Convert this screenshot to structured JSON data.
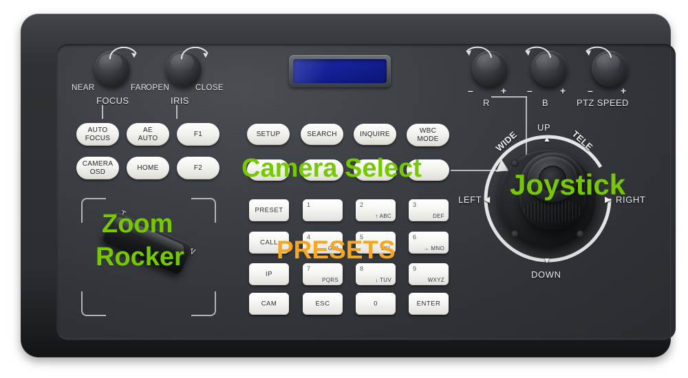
{
  "device": {
    "name": "PTZ camera joystick controller",
    "body_color": "#2e3135",
    "faceplate_color": "#3b3e43"
  },
  "display": {
    "name": "lcd-screen",
    "backlight_color": "#16239a",
    "text": ""
  },
  "knobs": [
    {
      "name": "focus",
      "label": "FOCUS",
      "left_label": "NEAR",
      "right_label": "FAR"
    },
    {
      "name": "iris",
      "label": "IRIS",
      "left_label": "OPEN",
      "right_label": "CLOSE"
    },
    {
      "name": "r-gain",
      "label": "R",
      "left_label": "–",
      "right_label": "+"
    },
    {
      "name": "b-gain",
      "label": "B",
      "left_label": "–",
      "right_label": "+"
    },
    {
      "name": "ptz-speed",
      "label": "PTZ SPEED",
      "left_label": "–",
      "right_label": "+"
    }
  ],
  "function_buttons": [
    {
      "name": "auto-focus",
      "line1": "AUTO",
      "line2": "FOCUS"
    },
    {
      "name": "ae-auto",
      "line1": "AE",
      "line2": "AUTO"
    },
    {
      "name": "f1",
      "line1": "F1",
      "line2": ""
    },
    {
      "name": "camera-osd",
      "line1": "CAMERA",
      "line2": "OSD"
    },
    {
      "name": "home",
      "line1": "HOME",
      "line2": ""
    },
    {
      "name": "f2",
      "line1": "F2",
      "line2": ""
    }
  ],
  "menu_buttons": [
    {
      "name": "setup",
      "line1": "SETUP",
      "line2": ""
    },
    {
      "name": "search",
      "line1": "SEARCH",
      "line2": ""
    },
    {
      "name": "inquire",
      "line1": "INQUIRE",
      "line2": ""
    },
    {
      "name": "wbc-mode",
      "line1": "WBC",
      "line2": "MODE"
    }
  ],
  "camera_select_buttons": [
    {
      "name": "camera-select-1",
      "label": ""
    },
    {
      "name": "camera-select-2",
      "label": ""
    },
    {
      "name": "camera-select-3",
      "label": ""
    },
    {
      "name": "camera-select-4",
      "label": ""
    }
  ],
  "keypad": {
    "rows": [
      [
        {
          "name": "preset",
          "main": "PRESET",
          "num": "",
          "sub": ""
        },
        {
          "name": "key-1",
          "main": "",
          "num": "1",
          "sub": ""
        },
        {
          "name": "key-2",
          "main": "",
          "num": "2",
          "sub": "↑ ABC"
        },
        {
          "name": "key-3",
          "main": "",
          "num": "3",
          "sub": "DEF"
        }
      ],
      [
        {
          "name": "call",
          "main": "CALL",
          "num": "",
          "sub": ""
        },
        {
          "name": "key-4",
          "main": "",
          "num": "4",
          "sub": "GHI"
        },
        {
          "name": "key-5",
          "main": "",
          "num": "5",
          "sub": "JKL"
        },
        {
          "name": "key-6",
          "main": "",
          "num": "6",
          "sub": "→ MNO"
        }
      ],
      [
        {
          "name": "ip",
          "main": "IP",
          "num": "",
          "sub": ""
        },
        {
          "name": "key-7",
          "main": "",
          "num": "7",
          "sub": "PQRS"
        },
        {
          "name": "key-8",
          "main": "",
          "num": "8",
          "sub": "↓ TUV"
        },
        {
          "name": "key-9",
          "main": "",
          "num": "9",
          "sub": "WXYZ"
        }
      ],
      [
        {
          "name": "cam",
          "main": "CAM",
          "num": "",
          "sub": ""
        },
        {
          "name": "esc",
          "main": "ESC",
          "num": "",
          "sub": ""
        },
        {
          "name": "key-0",
          "main": "0",
          "num": "",
          "sub": ""
        },
        {
          "name": "enter",
          "main": "ENTER",
          "num": "",
          "sub": ""
        }
      ]
    ]
  },
  "zoom_rocker": {
    "name": "zoom-rocker",
    "tele_label": "T",
    "wide_label": "W"
  },
  "joystick": {
    "name": "joystick",
    "up": "UP",
    "down": "DOWN",
    "left": "LEFT",
    "right": "RIGHT",
    "wide": "WIDE",
    "tele": "TELE",
    "up_arrow": "▲",
    "down_arrow": "▼",
    "left_arrow": "◀",
    "right_arrow": "▶"
  },
  "annotations": [
    {
      "name": "annotation-camera-select",
      "text": "Camera Select",
      "color": "#76c900"
    },
    {
      "name": "annotation-joystick",
      "text": "Joystick",
      "color": "#76c900"
    },
    {
      "name": "annotation-zoom",
      "text": "Zoom",
      "color": "#76c900"
    },
    {
      "name": "annotation-rocker",
      "text": "Rocker",
      "color": "#76c900"
    },
    {
      "name": "annotation-presets",
      "text": "PRESETS",
      "color": "#f5a623"
    }
  ]
}
